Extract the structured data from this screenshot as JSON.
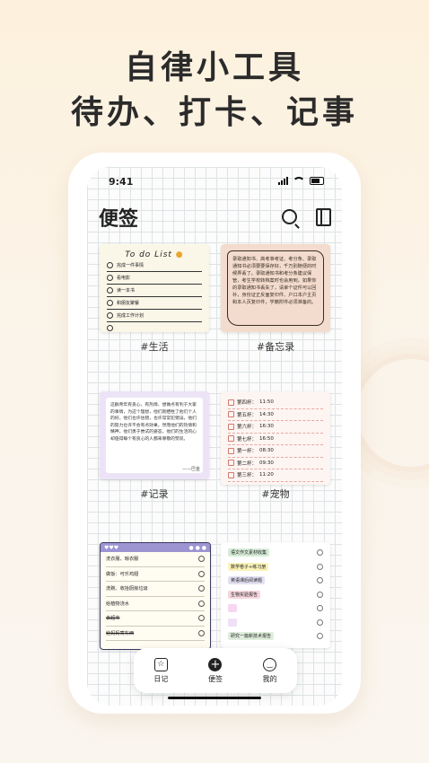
{
  "headline": {
    "line1": "自律小工具",
    "line2": "待办、打卡、记事"
  },
  "status_bar": {
    "time": "9:41"
  },
  "page": {
    "title": "便签"
  },
  "cards": {
    "todo": {
      "title": "To do List",
      "items": [
        "完成一件事情",
        "看电影",
        "读一本书",
        "和朋友聚餐",
        "完成工作计划",
        ""
      ],
      "caption": "#生活"
    },
    "memo": {
      "text": "录取通知书、高考准考证、考分条、录取通知书必须要要保存好，千万别随便的时候弄丢了。录取通知书和考分条建议保管，考生学校转档案时也会用到，如果你的录取通知书丢失了，请拿个证件可以回补，身份证正反面复印件、户口本户主页和本人页复印件，学籍附件必须准备的。",
      "caption": "#备忘录"
    },
    "record": {
      "text": "这群青年有良心、有热情、想做点有利于大家的事情，为这个理想，他们就牺牲了他们个人的好。他们也许估错，也许常常犯错误，他们的努力也许不会有点效果，然而他们的热情和精神，他们勇于尝试的姿态，他们的生活的心却值得每个有良心的人都来尊敬的赞叹。",
      "sign": "——巴金",
      "caption": "#记录"
    },
    "pet": {
      "items": [
        {
          "label": "第四杯：",
          "time": "11:50"
        },
        {
          "label": "第五杯：",
          "time": "14:30"
        },
        {
          "label": "第六杯：",
          "time": "16:30"
        },
        {
          "label": "第七杯：",
          "time": "16:50"
        },
        {
          "label": "第一杯：",
          "time": "08:30"
        },
        {
          "label": "第二杯：",
          "time": "09:30"
        },
        {
          "label": "第三杯：",
          "time": "11:20"
        }
      ],
      "caption": "#宠物"
    },
    "plan": {
      "items": [
        "洗衣服、晾衣服",
        "做饭：可乐鸡翅",
        "洗碗、收拾厨房垃圾",
        "给植物浇水",
        "去超市",
        "给妈妈寄东西"
      ]
    },
    "study": {
      "items": [
        "语文作文素材收集",
        "数学卷子+练习册",
        "英语课后阅读题",
        "生物实验报告",
        "",
        "",
        "研究一篇新技术报告"
      ],
      "colors": [
        "#d6ecd7",
        "#fbf3b8",
        "#e3e0f3",
        "#f6d6de",
        "#f6d6f0",
        "#efe0f5",
        "#e0eedd"
      ]
    }
  },
  "tabbar": {
    "diary": "日记",
    "notes": "便签",
    "mine": "我的"
  }
}
